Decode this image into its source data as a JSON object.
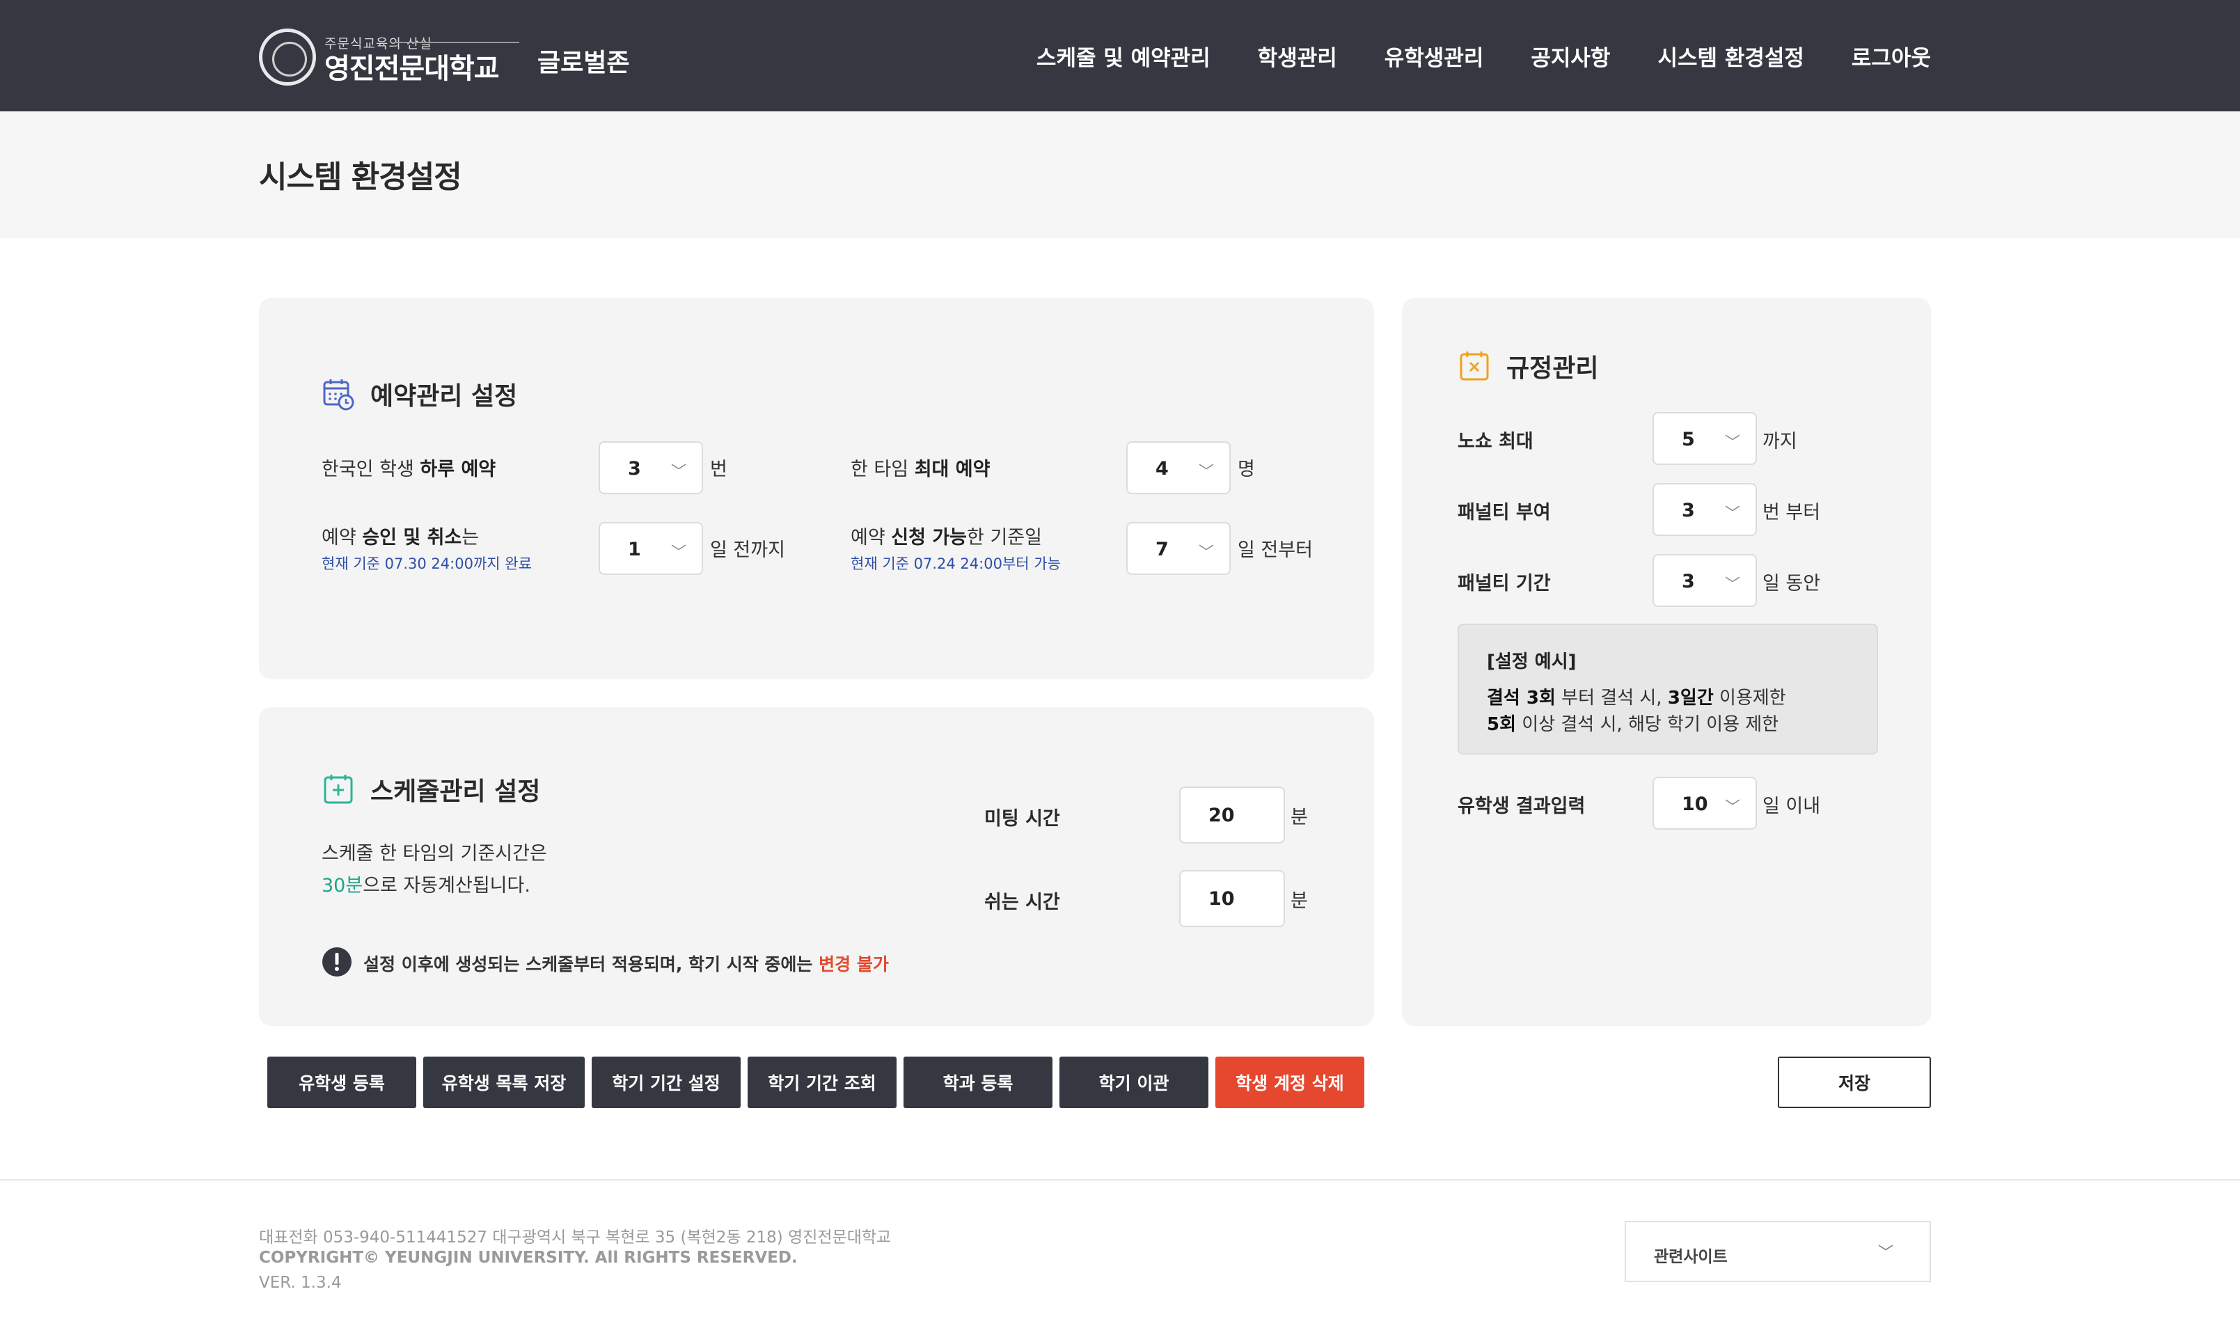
{
  "header": {
    "logo_sub": "주문식교육의 산실",
    "logo_main": "영진전문대학교",
    "logo_zone": "글로벌존",
    "nav": [
      "스케줄 및 예약관리",
      "학생관리",
      "유학생관리",
      "공지사항",
      "시스템 환경설정",
      "로그아웃"
    ]
  },
  "page": {
    "title": "시스템 환경설정"
  },
  "reservation": {
    "title": "예약관리 설정",
    "daily_label_pre": "한국인 학생 ",
    "daily_label_bold": "하루 예약",
    "daily_value": "3",
    "daily_unit": "번",
    "max_label_pre": "한 타임 ",
    "max_label_bold": "최대 예약",
    "max_value": "4",
    "max_unit": "명",
    "approve_label_pre": "예약 ",
    "approve_label_bold": "승인 및 취소",
    "approve_label_post": "는",
    "approve_note": "현재 기준 07.30 24:00까지 완료",
    "approve_value": "1",
    "approve_unit": "일 전까지",
    "apply_label_pre": "예약 ",
    "apply_label_bold": "신청 가능",
    "apply_label_post": "한 기준일",
    "apply_note": "현재 기준 07.24 24:00부터 가능",
    "apply_value": "7",
    "apply_unit": "일 전부터"
  },
  "schedule": {
    "title": "스케줄관리 설정",
    "desc_line1": "스케줄 한 타임의 기준시간은",
    "desc_highlight": "30분",
    "desc_line2_rest": "으로 자동계산됩니다.",
    "meeting_label": "미팅 시간",
    "meeting_value": "20",
    "meeting_unit": "분",
    "break_label": "쉬는 시간",
    "break_value": "10",
    "break_unit": "분",
    "warning_text": "설정 이후에 생성되는 스케줄부터 적용되며, 학기 시작 중에는 ",
    "warning_highlight": "변경 불가"
  },
  "rules": {
    "title": "규정관리",
    "noshow_label": "노쇼 최대",
    "noshow_value": "5",
    "noshow_unit": "까지",
    "penalty_label": "패널티 부여",
    "penalty_value": "3",
    "penalty_unit": "번 부터",
    "period_label": "패널티 기간",
    "period_value": "3",
    "period_unit": "일 동안",
    "example_title": "[설정 예시]",
    "example_l1_b1": "결석 3회",
    "example_l1_t1": " 부터 결석 시, ",
    "example_l1_b2": "3일간",
    "example_l1_t2": " 이용제한",
    "example_l2_b1": "5회",
    "example_l2_t1": " 이상 결석 시, 해당 학기 이용 제한",
    "result_label": "유학생 결과입력",
    "result_value": "10",
    "result_unit": "일 이내"
  },
  "buttons": {
    "register_intl": "유학생 등록",
    "save_intl_list": "유학생 목록 저장",
    "semester_set": "학기 기간 설정",
    "semester_view": "학기 기간 조회",
    "dept_register": "학과 등록",
    "semester_transfer": "학기 이관",
    "delete_accounts": "학생 계정 삭제",
    "save": "저장"
  },
  "footer": {
    "line1": "대표전화 053-940-511441527 대구광역시 북구 복현로 35 (복현2동 218) 영진전문대학교",
    "line2": "COPYRIGHT© YEUNGJIN UNIVERSITY. All RIGHTS RESERVED.",
    "line3": "VER. 1.3.4",
    "related": "관련사이트"
  },
  "colors": {
    "header_bg": "#353841",
    "accent_teal": "#1fa58a",
    "accent_red": "#e5472f",
    "note_blue": "#2e4fa8"
  },
  "icons": [
    "calendar-clock-icon",
    "calendar-plus-icon",
    "calendar-x-icon",
    "alert-circle-icon",
    "chevron-down-icon"
  ]
}
